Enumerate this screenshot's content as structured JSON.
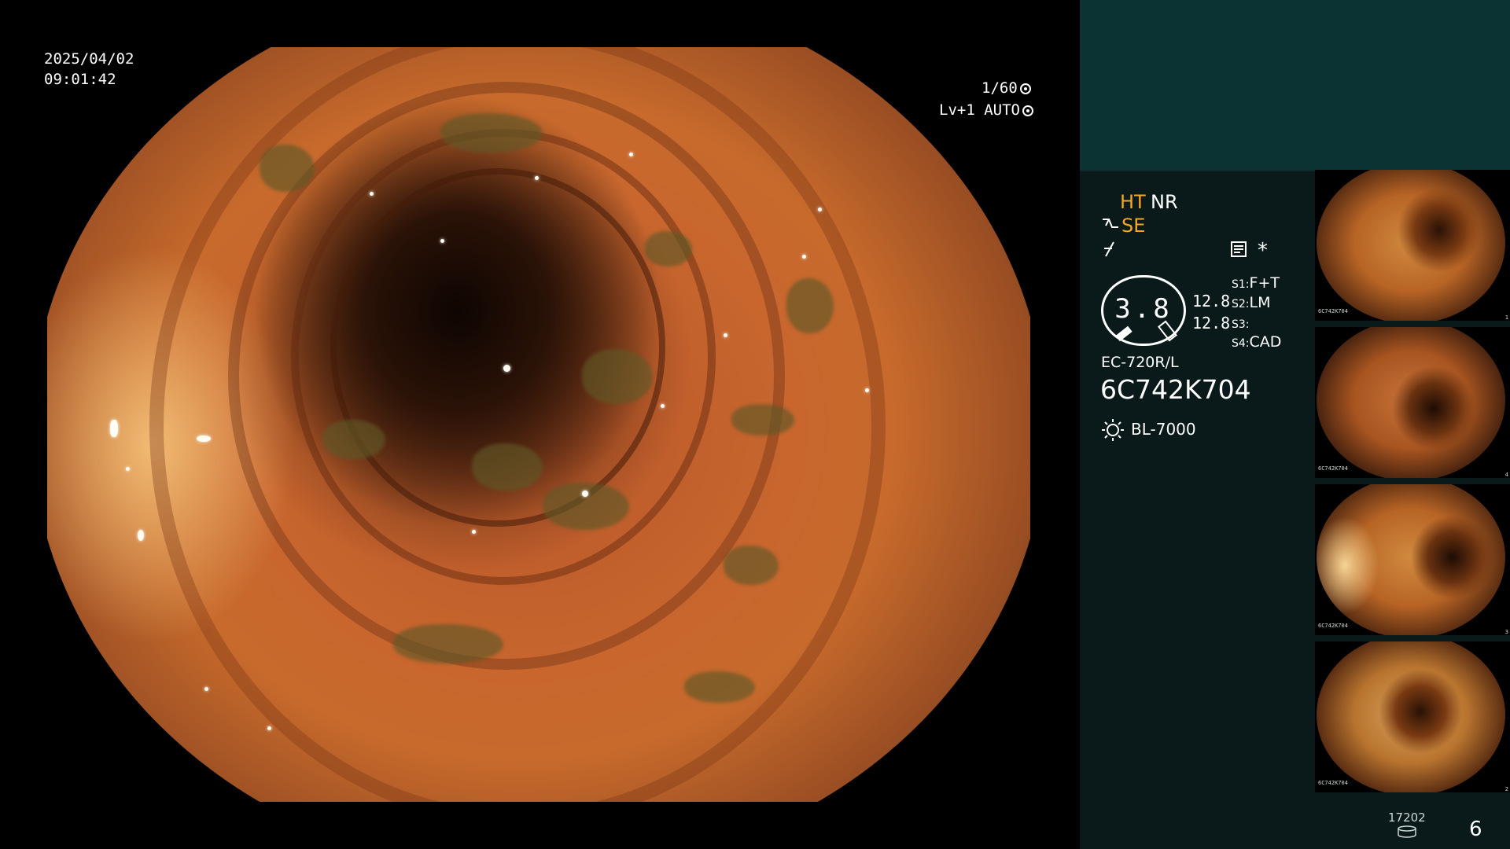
{
  "scope_view": {
    "date": "2025/04/02",
    "time": "09:01:42",
    "shutter": "1/60",
    "level": "Lv+1",
    "exposure_mode": "AUTO",
    "icons": [
      "aperture-icon",
      "iris-icon"
    ]
  },
  "panel": {
    "modes": {
      "ht": "HT",
      "nr": "NR",
      "se": "SE"
    },
    "icons": [
      "scope-tip-icon",
      "freeze-icon",
      "memo-icon",
      "asterisk-icon",
      "light-source-icon",
      "storage-icon"
    ],
    "asterisk": "*",
    "gauge_value": "3.8",
    "readings": [
      "12.8",
      "12.8"
    ],
    "switches": [
      {
        "key": "S1",
        "value": "F+T"
      },
      {
        "key": "S2",
        "value": "LM"
      },
      {
        "key": "S3",
        "value": ""
      },
      {
        "key": "S4",
        "value": "CAD"
      }
    ],
    "scope_model": "EC-720R/L",
    "scope_serial": "6C742K704",
    "light_source": "BL-7000",
    "storage_count": "17202",
    "image_count": "6"
  },
  "thumbnails": [
    {
      "index": "1",
      "serial": "6C742K704"
    },
    {
      "index": "4",
      "serial": "6C742K704"
    },
    {
      "index": "3",
      "serial": "6C742K704"
    },
    {
      "index": "2",
      "serial": "6C742K704"
    }
  ],
  "colors": {
    "panel_top": "#0c3333",
    "panel_bottom": "#0a1a1a",
    "accent_orange": "#f5a623",
    "mucosa": "#c8662e"
  }
}
